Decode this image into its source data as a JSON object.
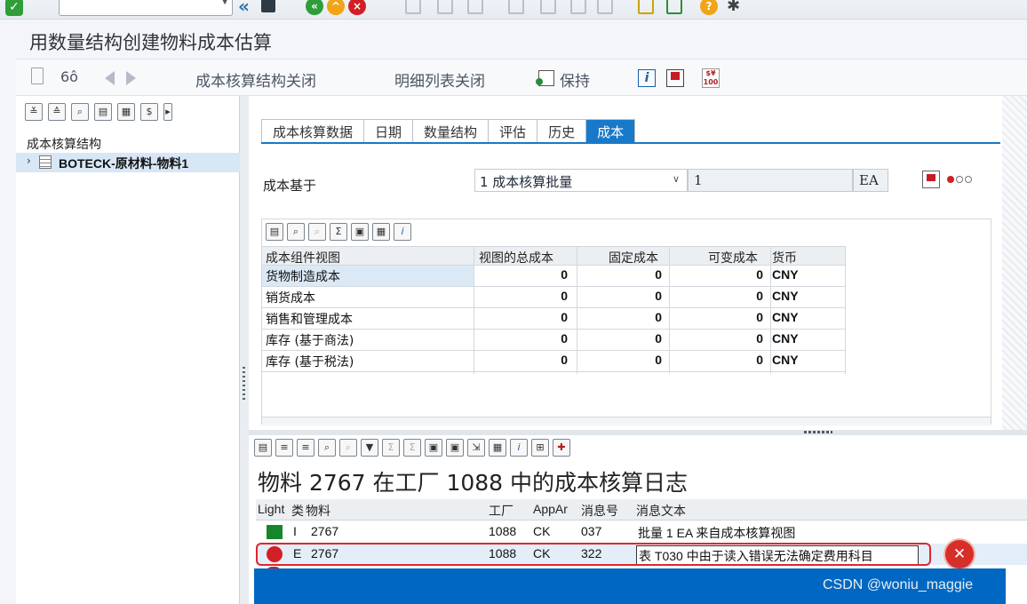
{
  "system_toolbar": {
    "ok_icon": "checkmark-icon",
    "command_field_value": ""
  },
  "title": "用数量结构创建物料成本估算",
  "app_toolbar": {
    "structure_close": "成本核算结构关闭",
    "detail_close": "明细列表关闭",
    "keep": "保持"
  },
  "left_pane": {
    "header": "成本核算结构",
    "tree_item": "BOTECK-原材料-物料1"
  },
  "tabs": [
    "成本核算数据",
    "日期",
    "数量结构",
    "评估",
    "历史",
    "成本"
  ],
  "active_tab": 5,
  "cost_base": {
    "label": "成本基于",
    "value": "1 成本核算批量",
    "quantity": "1",
    "unit": "EA"
  },
  "cost_grid": {
    "headers": [
      "成本组件视图",
      "视图的总成本",
      "固定成本",
      "可变成本",
      "货币"
    ],
    "rows": [
      [
        "货物制造成本",
        "0",
        "0",
        "0",
        "CNY"
      ],
      [
        "销货成本",
        "0",
        "0",
        "0",
        "CNY"
      ],
      [
        "销售和管理成本",
        "0",
        "0",
        "0",
        "CNY"
      ],
      [
        "库存 (基于商法)",
        "0",
        "0",
        "0",
        "CNY"
      ],
      [
        "库存 (基于税法)",
        "0",
        "0",
        "0",
        "CNY"
      ]
    ]
  },
  "log": {
    "title": "物料 2767 在工厂 1088 中的成本核算日志",
    "headers": [
      "Light",
      "类",
      "物料",
      "工厂",
      "AppAr",
      "消息号",
      "消息文本"
    ],
    "rows": [
      {
        "light": "green",
        "type": "I",
        "material": "2767",
        "plant": "1088",
        "area": "CK",
        "msg_no": "037",
        "text": "批量 1 EA 来自成本核算视图"
      },
      {
        "light": "red",
        "type": "E",
        "material": "2767",
        "plant": "1088",
        "area": "CK",
        "msg_no": "322",
        "text": "表 T030 中由于读入错误无法确定费用科目"
      }
    ]
  },
  "watermark": "CSDN @woniu_maggie",
  "colors": {
    "accent_blue": "#1979c9",
    "error_red": "#d21f26",
    "success_green": "#17862a",
    "overlay_blue": "#0068c2"
  }
}
